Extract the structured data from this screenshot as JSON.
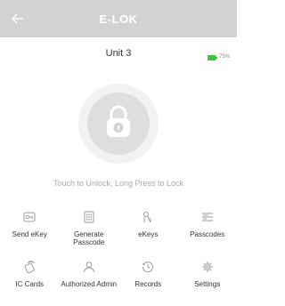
{
  "header": {
    "title": "E-LOK",
    "back_icon": "back-arrow-icon"
  },
  "lock": {
    "name": "Unit 3",
    "battery": {
      "percent_text": "75%",
      "level": 0.75,
      "color": "#3ec43e"
    },
    "icon": "padlock-icon"
  },
  "hint": "Touch to Unlock, Long Press to Lock",
  "menu": [
    {
      "label": "Send eKey",
      "icon": "send-ekey-icon"
    },
    {
      "label": "Generate Passcode",
      "icon": "keypad-icon"
    },
    {
      "label": "eKeys",
      "icon": "ekeys-icon"
    },
    {
      "label": "Passcodes",
      "icon": "passcodes-list-icon"
    },
    {
      "label": "IC Cards",
      "icon": "ic-card-icon"
    },
    {
      "label": "Authorized Admin",
      "icon": "admin-user-icon"
    },
    {
      "label": "Records",
      "icon": "records-clock-icon"
    },
    {
      "label": "Settings",
      "icon": "settings-gear-icon"
    }
  ]
}
